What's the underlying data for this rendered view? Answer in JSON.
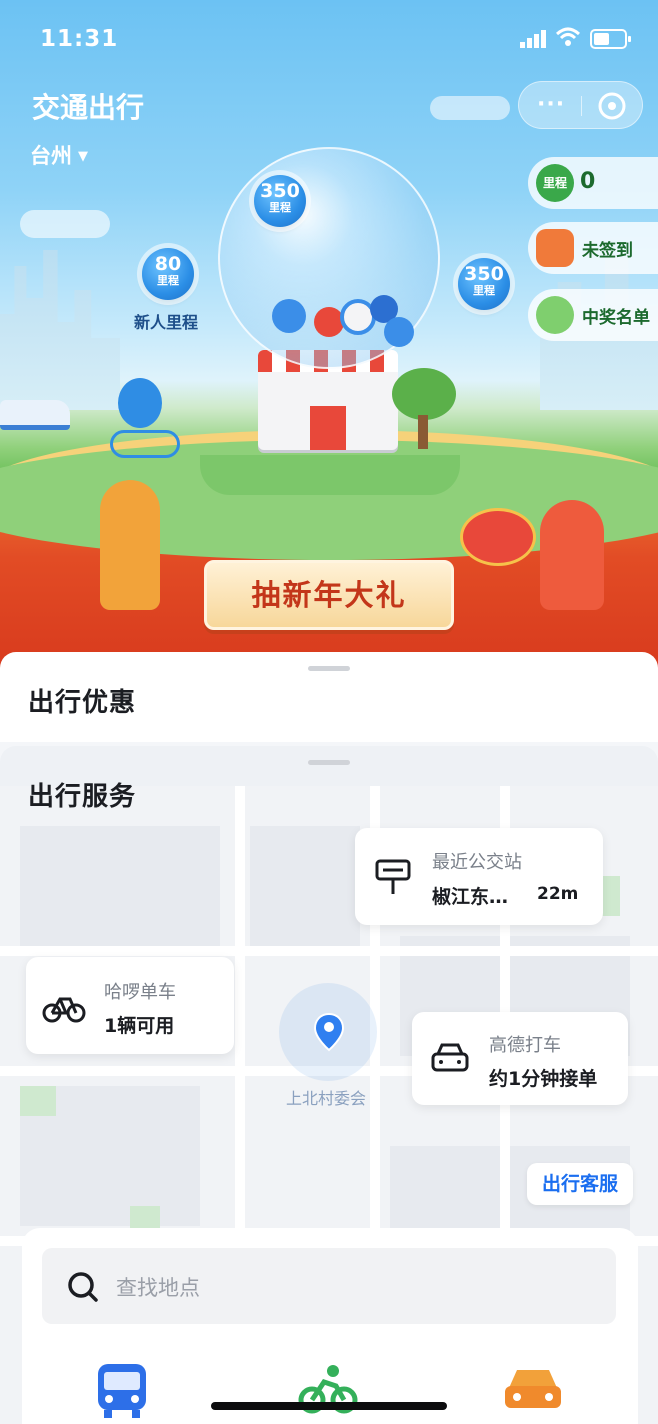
{
  "status_bar": {
    "time": "11:31"
  },
  "header": {
    "title": "交通出行",
    "city": "台州",
    "city_caret": "▼",
    "menu_dots": "···"
  },
  "side": {
    "mileage_label": "里程",
    "mileage_count": "0",
    "checkin": "未签到",
    "winners": "中奖名单"
  },
  "bubbles": [
    {
      "value": "350",
      "unit": "里程"
    },
    {
      "value": "80",
      "unit": "里程"
    },
    {
      "value": "350",
      "unit": "里程"
    }
  ],
  "new_user_label": "新人里程",
  "cta": {
    "label": "抽新年大礼"
  },
  "sections": {
    "deals": "出行优惠",
    "services": "出行服务"
  },
  "map": {
    "bus_stop": {
      "title": "最近公交站",
      "name": "椒江东…",
      "distance": "22m"
    },
    "bike": {
      "title": "哈啰单车",
      "status": "1辆可用"
    },
    "taxi": {
      "title": "高德打车",
      "status": "约1分钟接单"
    },
    "location": "上北村委会",
    "support": "出行客服"
  },
  "search": {
    "placeholder": "查找地点"
  },
  "colors": {
    "accent_blue": "#1a6ef0",
    "cta_red": "#c3361a",
    "mileage_green": "#1c6a2e"
  }
}
